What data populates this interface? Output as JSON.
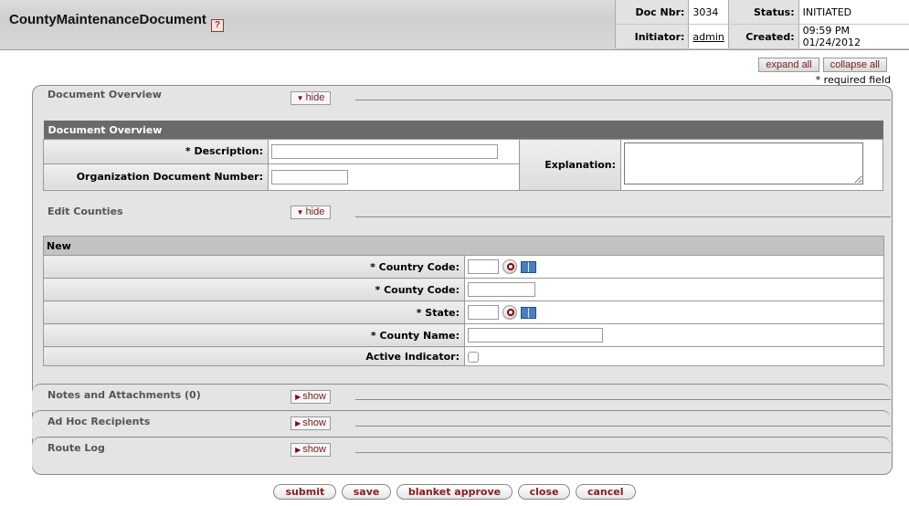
{
  "header": {
    "title": "CountyMaintenanceDocument",
    "help_icon": "question-mark-icon",
    "doc_nbr_label": "Doc Nbr:",
    "doc_nbr": "3034",
    "status_label": "Status:",
    "status": "INITIATED",
    "initiator_label": "Initiator:",
    "initiator": "admin",
    "created_label": "Created:",
    "created": "09:59 PM 01/24/2012"
  },
  "controls": {
    "expand_all": "expand all",
    "collapse_all": "collapse all",
    "required_note": "* required field"
  },
  "tabs": [
    {
      "label": "Document Overview",
      "toggle": "hide",
      "toggle_icon": "triangle-down-icon"
    },
    {
      "label": "Edit Counties",
      "toggle": "hide",
      "toggle_icon": "triangle-down-icon"
    },
    {
      "label": "Notes and Attachments (0)",
      "toggle": "show",
      "toggle_icon": "triangle-right-icon"
    },
    {
      "label": "Ad Hoc Recipients",
      "toggle": "show",
      "toggle_icon": "triangle-right-icon"
    },
    {
      "label": "Route Log",
      "toggle": "show",
      "toggle_icon": "triangle-right-icon"
    }
  ],
  "document_overview": {
    "section_title": "Document Overview",
    "description_label": "* Description:",
    "description_value": "",
    "org_doc_number_label": "Organization Document Number:",
    "org_doc_number_value": "",
    "explanation_label": "Explanation:",
    "explanation_value": ""
  },
  "edit_counties": {
    "section_title": "New",
    "fields": [
      {
        "label": "* Country Code:",
        "value": "",
        "lookup": true
      },
      {
        "label": "* County Code:",
        "value": "",
        "lookup": false
      },
      {
        "label": "* State:",
        "value": "",
        "lookup": true
      },
      {
        "label": "* County Name:",
        "value": "",
        "lookup": false
      },
      {
        "label": "Active Indicator:",
        "checked": false
      }
    ]
  },
  "actions": [
    "submit",
    "save",
    "blanket approve",
    "close",
    "cancel"
  ]
}
